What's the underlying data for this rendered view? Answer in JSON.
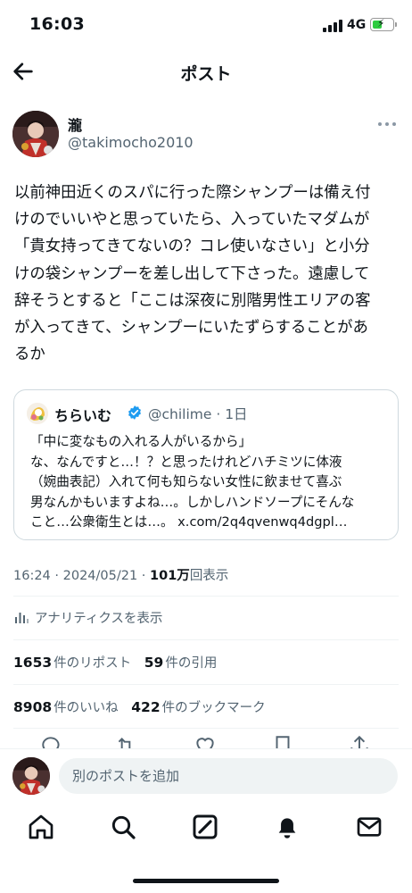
{
  "status_bar": {
    "time": "16:03",
    "network": "4G"
  },
  "header": {
    "title": "ポスト",
    "back_icon": "arrow-left-icon"
  },
  "post": {
    "author": {
      "name": "瀧",
      "handle": "@takimocho2010"
    },
    "text_lines": [
      "以前神田近くのスパに行った際シャンプーは備え付",
      "けのでいいやと思っていたら、入っていたマダムが",
      "「貴女持ってきてないの？コレ使いなさい」と小分",
      "けの袋シャンプーを差し出して下さった。遠慮して",
      "辞そうとすると「ここは深夜に別階男性エリアの客",
      "が入ってきて、シャンプーにいたずらすることがあ",
      "るか"
    ],
    "quote": {
      "name": "ちらいむ",
      "handle": "@chilime",
      "separator": " · ",
      "time": "1日",
      "verified_icon": "verified-badge-icon",
      "text_lines": [
        "「中に変なもの入れる人がいるから」",
        "な、なんですと…！？と思ったけれどハチミツに体液",
        "（婉曲表記）入れて何も知らない女性に飲ませて喜ぶ",
        "男なんかもいますよね…。しかしハンドソープにそんな",
        "こと…公衆衛生とは…。 x.com/2q4qvenwq4dgpl…"
      ]
    },
    "meta": {
      "time": "16:24",
      "date": "2024/05/21",
      "views": "101万",
      "views_label": "回表示",
      "separator": " · "
    },
    "analytics_label": "アナリティクスを表示",
    "stats": {
      "reposts": "1653",
      "reposts_label": "件のリポスト",
      "quotes": "59",
      "quotes_label": "件の引用",
      "likes": "8908",
      "likes_label": "件のいいね",
      "bookmarks": "422",
      "bookmarks_label": "件のブックマーク"
    }
  },
  "compose": {
    "placeholder": "別のポストを追加"
  },
  "tabbar": {
    "items": [
      "home-icon",
      "search-icon",
      "grok-icon",
      "notifications-icon",
      "messages-icon"
    ]
  },
  "colors": {
    "text": "#0f1419",
    "secondary": "#536471",
    "border": "#cfd9de",
    "verified": "#1d9bf0",
    "battery": "#2ecc40"
  }
}
